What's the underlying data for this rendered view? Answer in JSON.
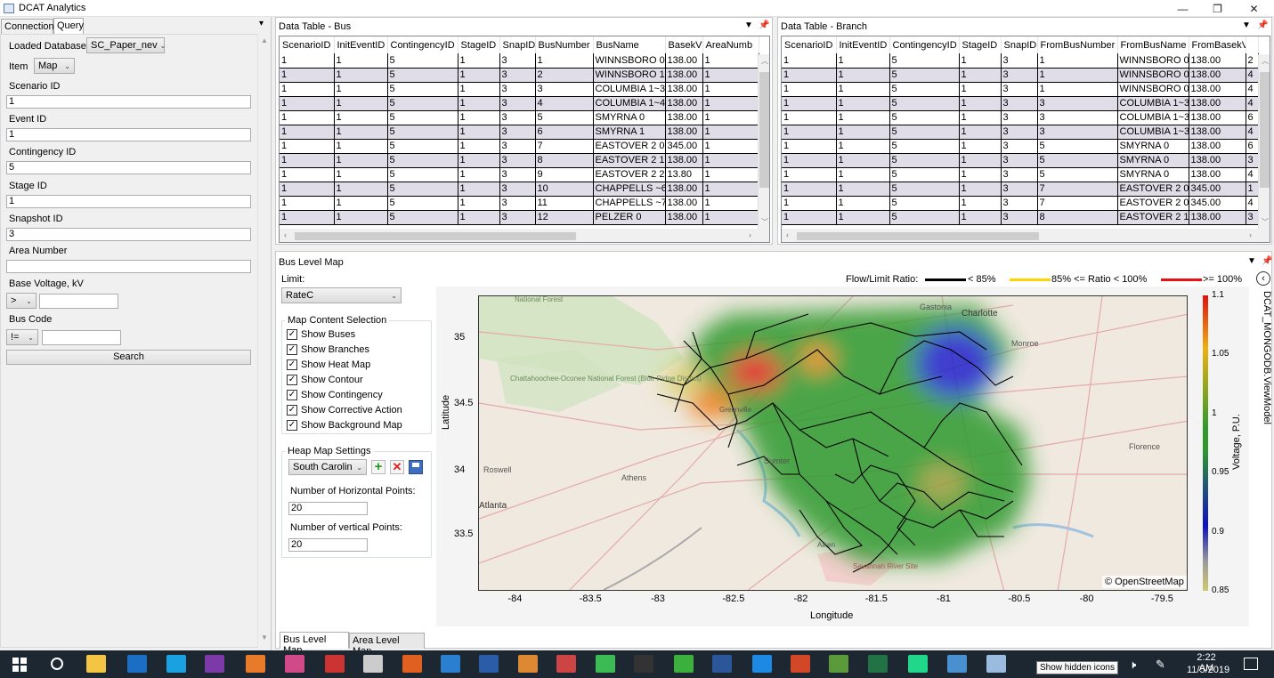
{
  "window": {
    "title": "DCAT Analytics",
    "min": "—",
    "max": "❐",
    "close": "✕"
  },
  "left": {
    "tabs": [
      "Connection",
      "Query"
    ],
    "pin": "▾",
    "loaded_db_label": "Loaded Database",
    "loaded_db_value": "SC_Paper_nev",
    "item_label": "Item",
    "item_value": "Map",
    "scenario_label": "Scenario ID",
    "scenario_value": "1",
    "event_label": "Event ID",
    "event_value": "1",
    "contingency_label": "Contingency ID",
    "contingency_value": "5",
    "stage_label": "Stage ID",
    "stage_value": "1",
    "snapshot_label": "Snapshot ID",
    "snapshot_value": "3",
    "area_label": "Area Number",
    "area_value": "",
    "voltage_label": "Base Voltage, kV",
    "voltage_op": ">",
    "voltage_value": "",
    "buscode_label": "Bus Code",
    "buscode_op": "!=",
    "buscode_value": "",
    "search": "Search"
  },
  "bus_table": {
    "title": "Data Table - Bus",
    "columns": [
      "ScenarioID",
      "InitEventID",
      "ContingencyID",
      "StageID",
      "SnapID",
      "BusNumber",
      "BusName",
      "BasekV",
      "AreaNumb"
    ],
    "rows": [
      [
        "1",
        "1",
        "5",
        "1",
        "3",
        "1",
        "WINNSBORO 0",
        "138.00",
        "1"
      ],
      [
        "1",
        "1",
        "5",
        "1",
        "3",
        "2",
        "WINNSBORO 1",
        "138.00",
        "1"
      ],
      [
        "1",
        "1",
        "5",
        "1",
        "3",
        "3",
        "COLUMBIA 1~3",
        "138.00",
        "1"
      ],
      [
        "1",
        "1",
        "5",
        "1",
        "3",
        "4",
        "COLUMBIA 1~4",
        "138.00",
        "1"
      ],
      [
        "1",
        "1",
        "5",
        "1",
        "3",
        "5",
        "SMYRNA 0",
        "138.00",
        "1"
      ],
      [
        "1",
        "1",
        "5",
        "1",
        "3",
        "6",
        "SMYRNA 1",
        "138.00",
        "1"
      ],
      [
        "1",
        "1",
        "5",
        "1",
        "3",
        "7",
        "EASTOVER 2 0",
        "345.00",
        "1"
      ],
      [
        "1",
        "1",
        "5",
        "1",
        "3",
        "8",
        "EASTOVER 2 1",
        "138.00",
        "1"
      ],
      [
        "1",
        "1",
        "5",
        "1",
        "3",
        "9",
        "EASTOVER 2 2",
        "13.80",
        "1"
      ],
      [
        "1",
        "1",
        "5",
        "1",
        "3",
        "10",
        "CHAPPELLS ~6",
        "138.00",
        "1"
      ],
      [
        "1",
        "1",
        "5",
        "1",
        "3",
        "11",
        "CHAPPELLS ~7",
        "138.00",
        "1"
      ],
      [
        "1",
        "1",
        "5",
        "1",
        "3",
        "12",
        "PELZER 0",
        "138.00",
        "1"
      ]
    ]
  },
  "branch_table": {
    "title": "Data Table - Branch",
    "columns": [
      "ScenarioID",
      "InitEventID",
      "ContingencyID",
      "StageID",
      "SnapID",
      "FromBusNumber",
      "FromBusName",
      "FromBasekV",
      ""
    ],
    "rows": [
      [
        "1",
        "1",
        "5",
        "1",
        "3",
        "1",
        "WINNSBORO 0",
        "138.00",
        "2"
      ],
      [
        "1",
        "1",
        "5",
        "1",
        "3",
        "1",
        "WINNSBORO 0",
        "138.00",
        "4"
      ],
      [
        "1",
        "1",
        "5",
        "1",
        "3",
        "1",
        "WINNSBORO 0",
        "138.00",
        "4"
      ],
      [
        "1",
        "1",
        "5",
        "1",
        "3",
        "3",
        "COLUMBIA 1~3",
        "138.00",
        "4"
      ],
      [
        "1",
        "1",
        "5",
        "1",
        "3",
        "3",
        "COLUMBIA 1~3",
        "138.00",
        "6"
      ],
      [
        "1",
        "1",
        "5",
        "1",
        "3",
        "3",
        "COLUMBIA 1~3",
        "138.00",
        "4"
      ],
      [
        "1",
        "1",
        "5",
        "1",
        "3",
        "5",
        "SMYRNA 0",
        "138.00",
        "6"
      ],
      [
        "1",
        "1",
        "5",
        "1",
        "3",
        "5",
        "SMYRNA 0",
        "138.00",
        "3"
      ],
      [
        "1",
        "1",
        "5",
        "1",
        "3",
        "5",
        "SMYRNA 0",
        "138.00",
        "4"
      ],
      [
        "1",
        "1",
        "5",
        "1",
        "3",
        "7",
        "EASTOVER 2 0",
        "345.00",
        "1"
      ],
      [
        "1",
        "1",
        "5",
        "1",
        "3",
        "7",
        "EASTOVER 2 0",
        "345.00",
        "4"
      ],
      [
        "1",
        "1",
        "5",
        "1",
        "3",
        "8",
        "EASTOVER 2 1",
        "138.00",
        "3"
      ]
    ]
  },
  "map": {
    "title": "Bus Level Map",
    "limit_label": "Limit:",
    "limit_value": "RateC",
    "content_group": "Map Content Selection",
    "checks": [
      "Show Buses",
      "Show Branches",
      "Show Heat Map",
      "Show Contour",
      "Show Contingency",
      "Show Corrective Action",
      "Show Background Map"
    ],
    "heat_group": "Heap Map Settings",
    "region": "South Carolin",
    "h_label": "Number of Horizontal Points:",
    "h_value": "20",
    "v_label": "Number of vertical Points:",
    "v_value": "20",
    "legend_title": "Flow/Limit Ratio:",
    "legend": [
      {
        "label": "< 85%",
        "color": "#000000"
      },
      {
        "label": "85% <= Ratio < 100%",
        "color": "#ffd400"
      },
      {
        "label": ">= 100%",
        "color": "#e81010"
      }
    ],
    "xlabel": "Longitude",
    "ylabel": "Latitude",
    "xticks": [
      "-84",
      "-83.5",
      "-83",
      "-82.5",
      "-82",
      "-81.5",
      "-81",
      "-80.5",
      "-80",
      "-79.5"
    ],
    "yticks": [
      "35",
      "34.5",
      "34",
      "33.5"
    ],
    "colorbar_label": "Voltage, P.U.",
    "colorbar_ticks": [
      "1.1",
      "1.05",
      "1",
      "0.95",
      "0.9",
      "0.85"
    ],
    "attribution": "© OpenStreetMap",
    "places": [
      "Charlotte",
      "Monroe",
      "Gastonia",
      "Athens",
      "Atlanta",
      "Roswell",
      "Sumter",
      "Florence",
      "Chattahoochee-Oconee National Forest (Blue Ridge District)",
      "Savannah River Site",
      "National Forest",
      "Greenville",
      "Aiken"
    ],
    "side_tab": "DCAT_MONGODB.ViewModel",
    "bottom_tabs": [
      "Bus Level Map",
      "Area Level Map"
    ]
  },
  "taskbar": {
    "time": "2:22 AM",
    "date": "11/5/2019",
    "tooltip": "Show hidden icons"
  }
}
